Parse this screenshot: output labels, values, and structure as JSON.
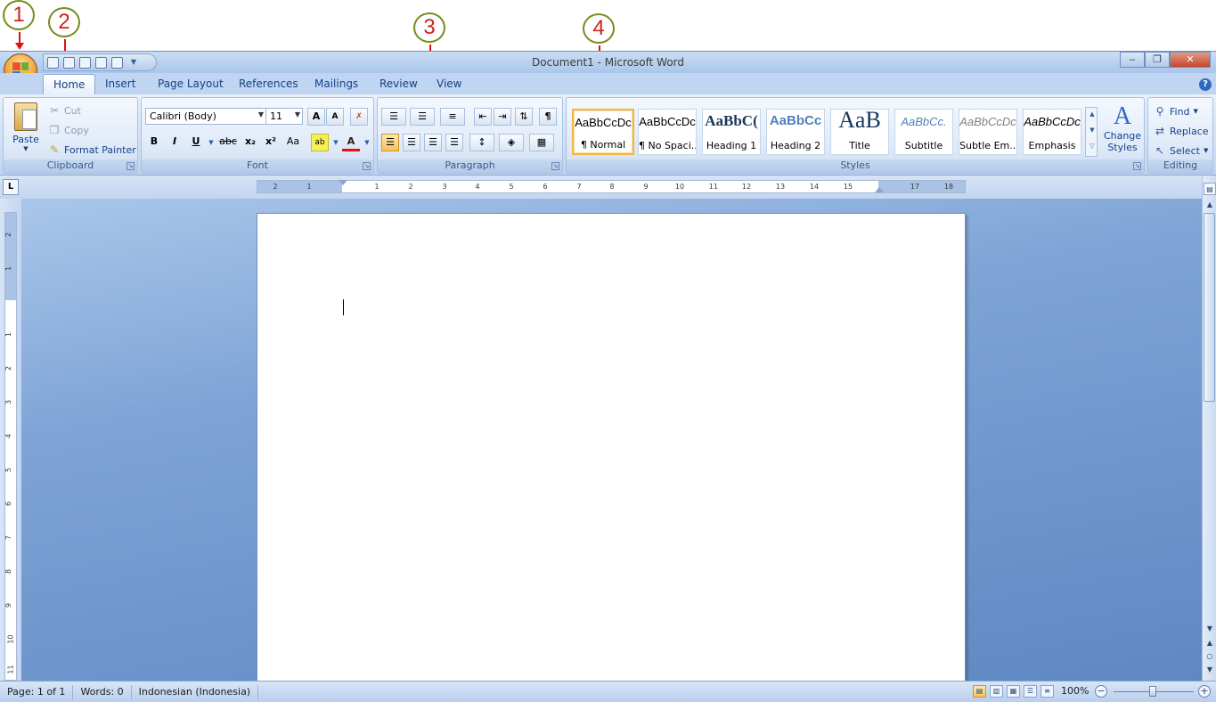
{
  "annotations": [
    "1",
    "2",
    "3",
    "4"
  ],
  "title": "Document1 - Microsoft Word",
  "window_buttons": {
    "minimize": "‒",
    "restore": "❐",
    "close": "✕"
  },
  "tabs": [
    "Home",
    "Insert",
    "Page Layout",
    "References",
    "Mailings",
    "Review",
    "View"
  ],
  "help": "?",
  "clipboard": {
    "paste": "Paste",
    "cut": "Cut",
    "copy": "Copy",
    "format_painter": "Format Painter",
    "label": "Clipboard"
  },
  "font": {
    "family": "Calibri (Body)",
    "size": "11",
    "grow": "A",
    "shrink": "A",
    "bold": "B",
    "italic": "I",
    "underline": "U",
    "strike": "abc",
    "subscript": "x₂",
    "superscript": "x²",
    "change_case": "Aa",
    "highlight": "ab",
    "font_color": "A",
    "label": "Font"
  },
  "paragraph": {
    "label": "Paragraph",
    "show_marks": "¶"
  },
  "styles": {
    "label": "Styles",
    "items": [
      {
        "sample": "AaBbCcDc",
        "name": "¶ Normal"
      },
      {
        "sample": "AaBbCcDc",
        "name": "¶ No Spaci..."
      },
      {
        "sample": "AaBbC(",
        "name": "Heading 1"
      },
      {
        "sample": "AaBbCc",
        "name": "Heading 2"
      },
      {
        "sample": "AaB",
        "name": "Title"
      },
      {
        "sample": "AaBbCc.",
        "name": "Subtitle"
      },
      {
        "sample": "AaBbCcDc",
        "name": "Subtle Em..."
      },
      {
        "sample": "AaBbCcDc",
        "name": "Emphasis"
      }
    ],
    "change_styles": [
      "Change",
      "Styles"
    ]
  },
  "editing": {
    "find": "Find",
    "replace": "Replace",
    "select": "Select",
    "label": "Editing"
  },
  "ruler_numbers": [
    "2",
    "1",
    "1",
    "2",
    "3",
    "4",
    "5",
    "6",
    "7",
    "8",
    "9",
    "10",
    "11",
    "12",
    "13",
    "14",
    "15",
    "17",
    "18"
  ],
  "vruler_numbers": [
    "2",
    "1",
    "1",
    "2",
    "3",
    "4",
    "5",
    "6",
    "7",
    "8",
    "9",
    "10",
    "11"
  ],
  "status": {
    "page": "Page: 1 of 1",
    "words": "Words: 0",
    "language": "Indonesian (Indonesia)",
    "zoom": "100%"
  },
  "colors": {
    "accent_red": "#e01010",
    "callout_border": "#7a8a1a",
    "ribbon_blue": "#15428b"
  }
}
